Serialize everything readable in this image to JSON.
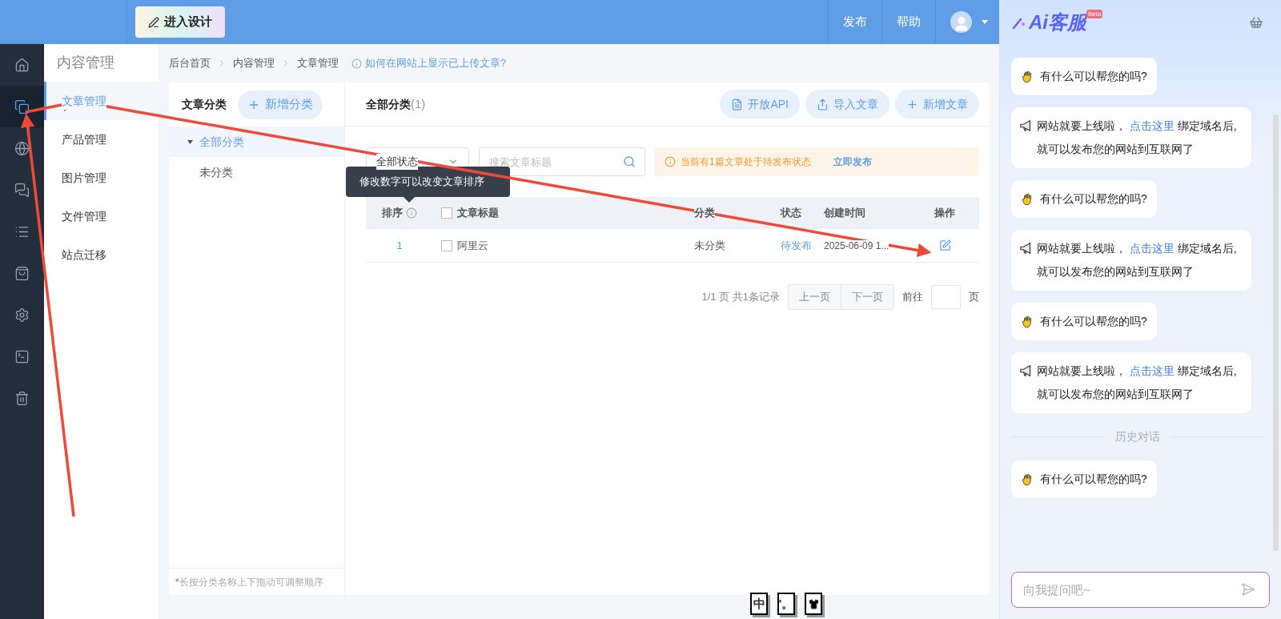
{
  "top_bar": {
    "design_button": "进入设计",
    "links": [
      "发布",
      "帮助"
    ]
  },
  "rail": [
    {
      "kind": "home",
      "selected": false
    },
    {
      "kind": "pages",
      "selected": true
    },
    {
      "kind": "planet",
      "selected": false
    },
    {
      "kind": "chat",
      "selected": false
    },
    {
      "kind": "list",
      "selected": false
    },
    {
      "kind": "bag",
      "selected": false
    },
    {
      "kind": "settings",
      "selected": false
    },
    {
      "kind": "terminal",
      "selected": false
    },
    {
      "kind": "trash",
      "selected": false
    }
  ],
  "sidebar": {
    "title": "内容管理",
    "items": [
      {
        "label": "文章管理",
        "selected": true
      },
      {
        "label": "产品管理",
        "selected": false
      },
      {
        "label": "图片管理",
        "selected": false
      },
      {
        "label": "文件管理",
        "selected": false
      },
      {
        "label": "站点迁移",
        "selected": false
      }
    ]
  },
  "breadcrumb": [
    "后台首页",
    "内容管理",
    "文章管理"
  ],
  "help_link": "如何在网站上显示已上传文章?",
  "categories": {
    "title": "文章分类",
    "add_button": "新增分类",
    "tree": [
      {
        "label": "全部分类",
        "selected": true,
        "expanded": true,
        "children": [
          {
            "label": "未分类",
            "selected": false
          }
        ]
      }
    ],
    "note_mark": "*",
    "note": "长按分类名称上下拖动可调整顺序"
  },
  "articles": {
    "title": "全部分类",
    "count": "(1)",
    "buttons": [
      {
        "kind": "api",
        "label": "开放API"
      },
      {
        "kind": "import",
        "label": "导入文章"
      },
      {
        "kind": "add",
        "label": "新增文章"
      }
    ],
    "status_select": "全部状态",
    "search": {
      "placeholder": "搜索文章标题"
    },
    "notice": "当前有1篇文章处于待发布状态",
    "notice_action": "立即发布",
    "tooltip": "修改数字可以改变文章排序",
    "columns": [
      "排序",
      "文章标题",
      "分类",
      "状态",
      "创建时间",
      "操作"
    ],
    "header_checked": false,
    "rows": [
      {
        "order": "1",
        "title": "阿里云",
        "category": "未分类",
        "status": "待发布",
        "created": "2025-06-09 1...",
        "checked": false
      }
    ],
    "pagination": {
      "summary": "1/1 页 共1条记录",
      "prev": "上一页",
      "next": "下一页",
      "goto": "前往",
      "unit": "页"
    }
  },
  "chat": {
    "title": "Ai客服",
    "badge": "Beta",
    "messages": [
      {
        "kind": "greeting",
        "text": "有什么可以帮您的吗?"
      },
      {
        "kind": "notice",
        "before": "网站就要上线啦，",
        "link": "点击这里",
        "after": "绑定域名后,就可以发布您的网站到互联网了"
      },
      {
        "kind": "greeting",
        "text": "有什么可以帮您的吗?"
      },
      {
        "kind": "notice",
        "before": "网站就要上线啦，",
        "link": "点击这里",
        "after": "绑定域名后,就可以发布您的网站到互联网了"
      },
      {
        "kind": "greeting",
        "text": "有什么可以帮您的吗?"
      },
      {
        "kind": "notice",
        "before": "网站就要上线啦，",
        "link": "点击这里",
        "after": "绑定域名后,就可以发布您的网站到互联网了"
      },
      {
        "kind": "divider",
        "text": "历史对话"
      },
      {
        "kind": "greeting",
        "text": "有什么可以帮您的吗?"
      }
    ],
    "input": {
      "placeholder": "向我提问吧~"
    }
  },
  "ime": [
    "中",
    "'。"
  ]
}
